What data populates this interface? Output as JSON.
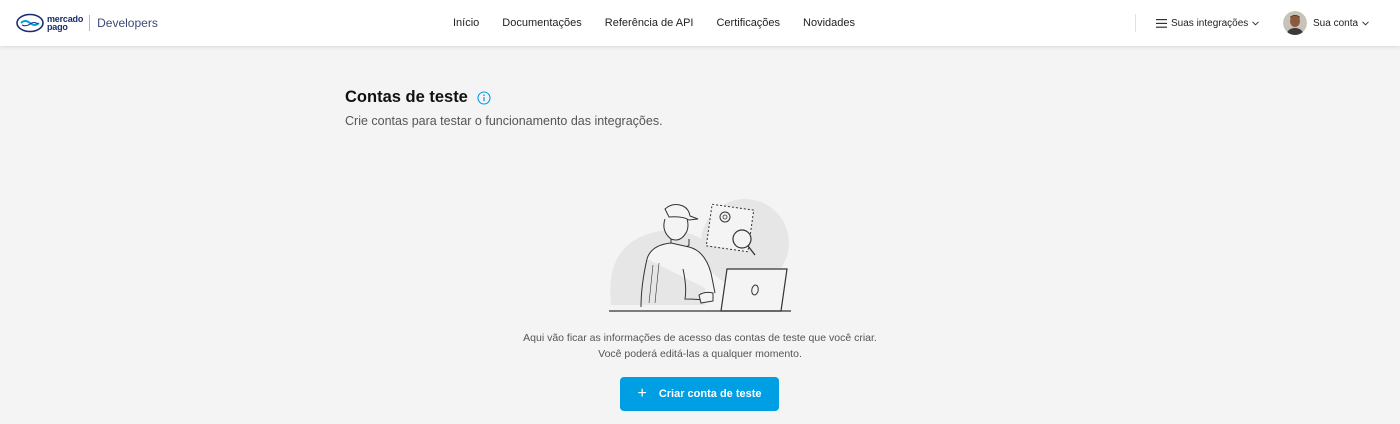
{
  "header": {
    "brand_line1": "mercado",
    "brand_line2": "pago",
    "brand_product": "Developers",
    "nav": [
      {
        "label": "Início"
      },
      {
        "label": "Documentações"
      },
      {
        "label": "Referência de API"
      },
      {
        "label": "Certificações"
      },
      {
        "label": "Novidades"
      }
    ],
    "integrations_label": "Suas integrações",
    "account_label": "Sua conta"
  },
  "main": {
    "title": "Contas de teste",
    "subtitle": "Crie contas para testar o funcionamento das integrações.",
    "empty_line1": "Aqui vão ficar as informações de acesso das contas de teste que você criar.",
    "empty_line2": "Você poderá editá-las a qualquer momento.",
    "cta_label": "Criar conta de teste"
  },
  "colors": {
    "accent": "#009ee3",
    "brand_navy": "#1a2c6e",
    "background": "#f4f4f4"
  },
  "icons": [
    "mercadopago-logo",
    "info-icon",
    "menu-list-icon",
    "chevron-down-icon",
    "avatar",
    "plus-icon",
    "empty-state-illustration"
  ]
}
